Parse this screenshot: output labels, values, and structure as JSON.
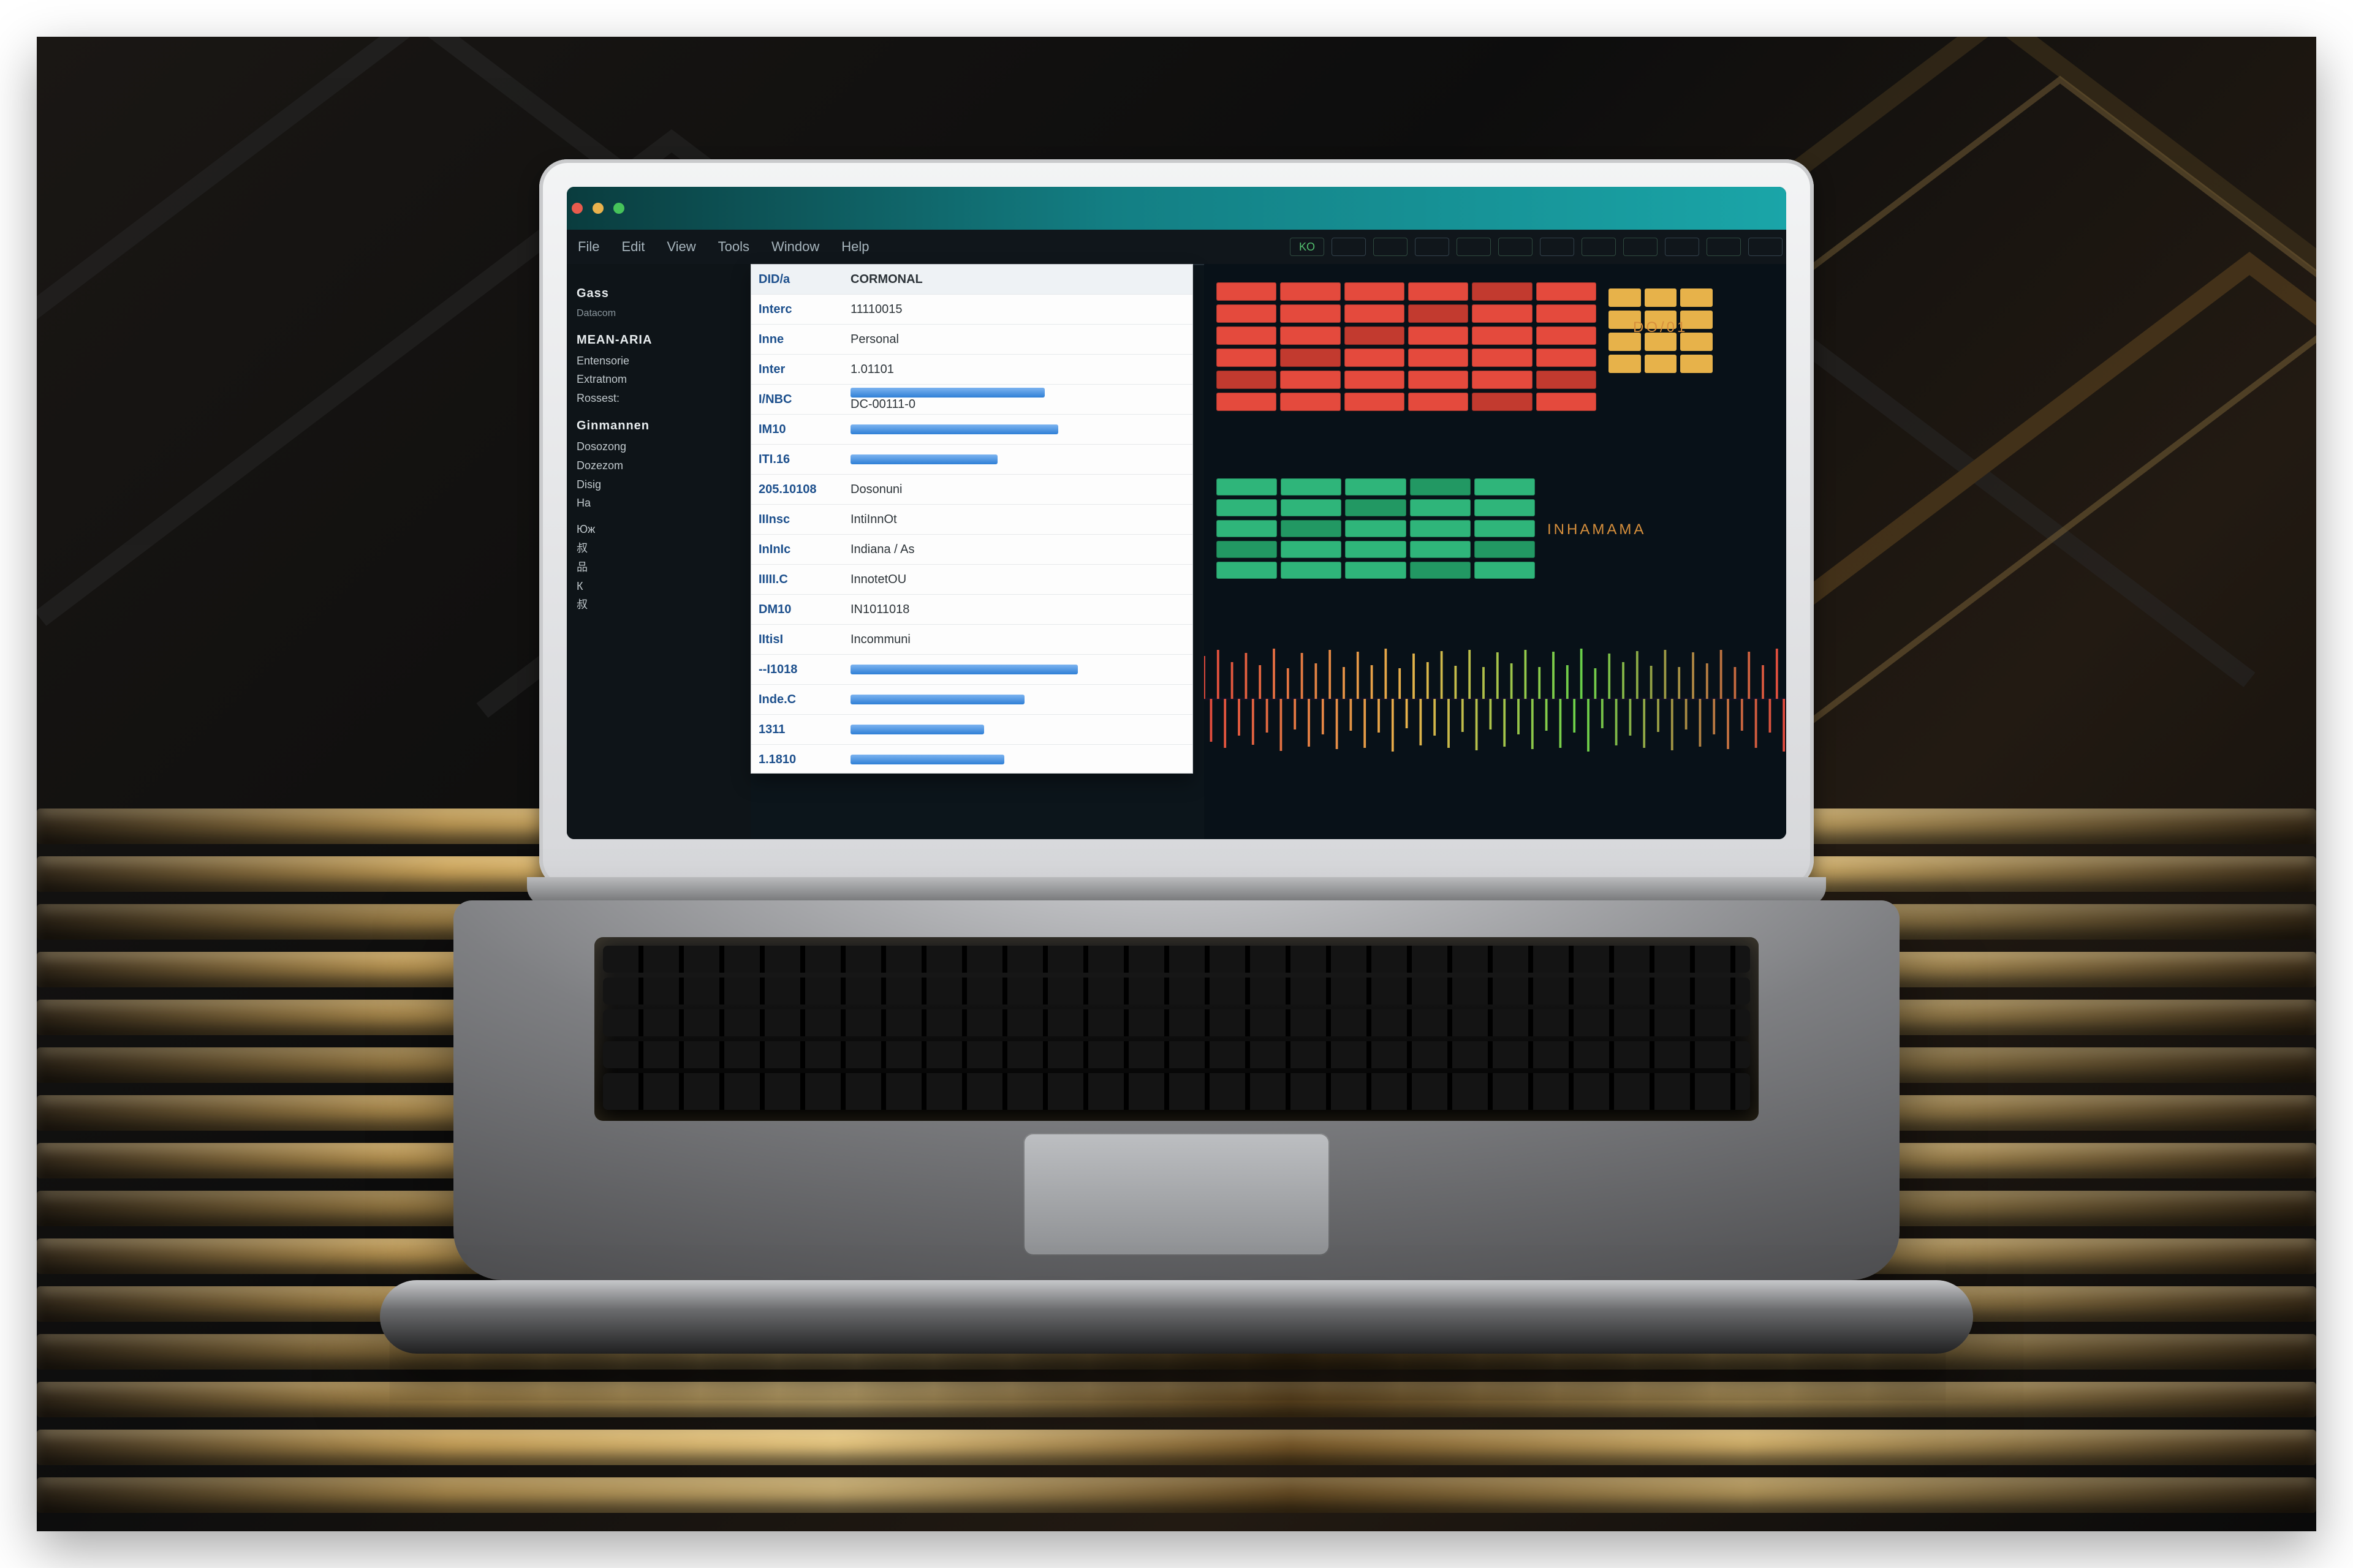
{
  "note": "Source image is an AI-style render of a laptop; most on‑screen text is synthetic/illegible. Values below are approximations of what is visually suggested, not exact strings.",
  "titlebar": {
    "title": ""
  },
  "menubar": {
    "items": [
      "File",
      "Edit",
      "View",
      "Tools",
      "Window",
      "Help"
    ],
    "status_chips": [
      "KO",
      "",
      "",
      "",
      "",
      "",
      "",
      "",
      "",
      "",
      "",
      ""
    ]
  },
  "sidebar": {
    "section1": {
      "title": "Gass",
      "subtitle": "Datacom"
    },
    "section2": {
      "title": "MEAN-ARIA",
      "items": [
        "Entensorie",
        "Extratnom",
        "Rossest:"
      ]
    },
    "section3": {
      "title": "Ginmannen",
      "items": [
        "Dosozong",
        "Dozezom",
        "Disig",
        "На"
      ]
    },
    "section4_items": [
      "Юж",
      "叔",
      "品",
      "К",
      "叔",
      "",
      "一",
      "一"
    ]
  },
  "center_panel": {
    "header": {
      "k": "DID/a",
      "v": "CORMONAL"
    },
    "rows": [
      {
        "k": "Interc",
        "v": "11110015"
      },
      {
        "k": "Inne",
        "v": "Personal"
      },
      {
        "k": "Inter",
        "v": "1.01101"
      },
      {
        "k": "I/NBC",
        "v": "DC-00111-0",
        "bar": 58
      },
      {
        "k": "IM10",
        "v": "",
        "bar": 62
      },
      {
        "k": "ITI.16",
        "v": "",
        "bar": 44
      },
      {
        "k": "205.10108",
        "v": "Dosonuni"
      },
      {
        "k": "IIInsc",
        "v": "IntiInnOt"
      },
      {
        "k": "InInIc",
        "v": "Indiana / As"
      },
      {
        "k": "IIIII.C",
        "v": "InnotetOU"
      },
      {
        "k": "DM10",
        "v": "IN1011018"
      },
      {
        "k": "IItisI",
        "v": "Incommuni"
      },
      {
        "k": "--I1018",
        "v": "",
        "bar": 68
      },
      {
        "k": "Inde.C",
        "v": "",
        "bar": 52
      },
      {
        "k": "1311",
        "v": "",
        "bar": 40
      },
      {
        "k": "1.1810",
        "v": "",
        "bar": 46
      }
    ]
  },
  "right_panel": {
    "label1": "DO/01",
    "label2": "INHAMAMA"
  }
}
